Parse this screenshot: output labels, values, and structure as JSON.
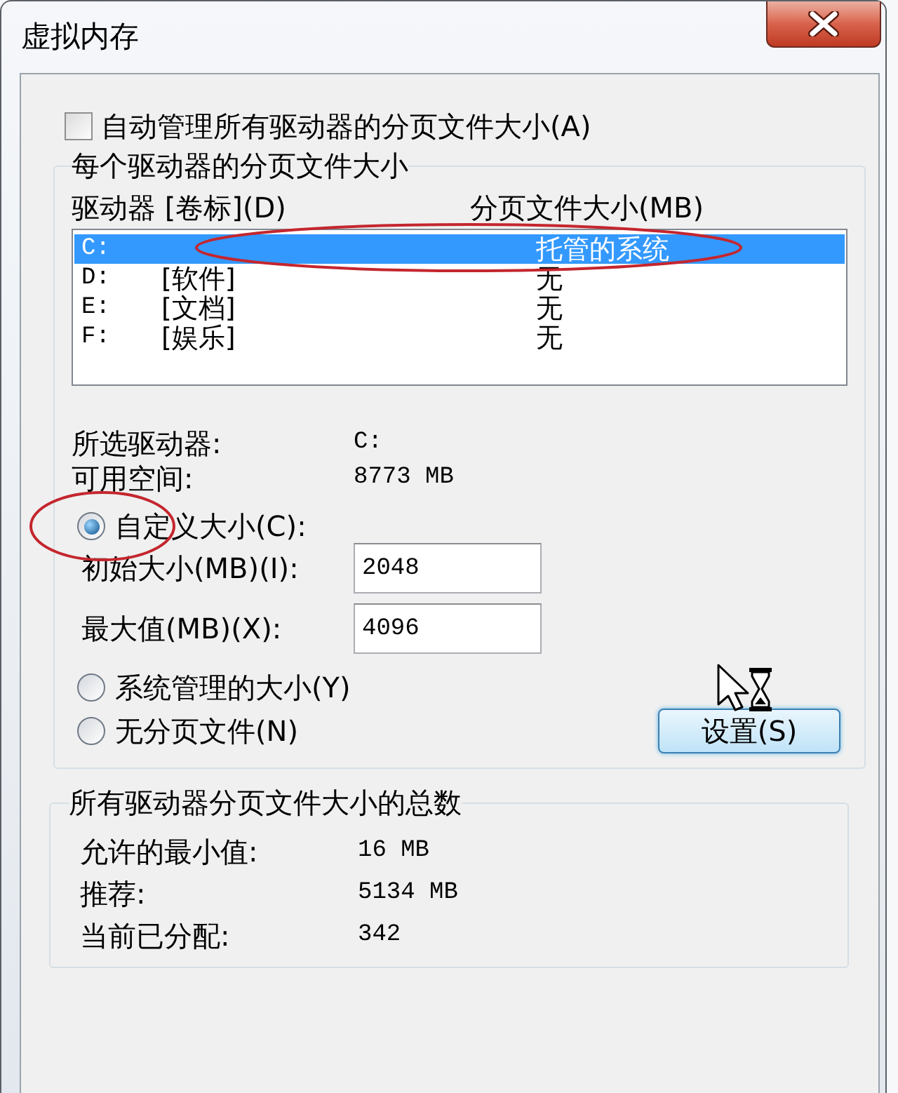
{
  "window": {
    "title": "虚拟内存"
  },
  "auto_manage": {
    "label": "自动管理所有驱动器的分页文件大小(A)",
    "checked": false
  },
  "per_drive_group": {
    "title": "每个驱动器的分页文件大小",
    "columns": [
      "驱动器 [卷标](D)",
      "分页文件大小(MB)"
    ],
    "drives": [
      {
        "drive": "C:",
        "paging_file_size": "托管的系统",
        "selected": true
      },
      {
        "drive": "D:",
        "volume_label": "[软件]",
        "paging_file_size": "无",
        "selected": false
      },
      {
        "drive": "E:",
        "volume_label": "[文档]",
        "paging_file_size": "无",
        "selected": false
      },
      {
        "drive": "F:",
        "volume_label": "[娱乐]",
        "paging_file_size": "无",
        "selected": false
      }
    ],
    "selected_drive": {
      "label": "所选驱动器:",
      "value": "C:"
    },
    "free_space": {
      "label": "可用空间:",
      "value": "8773 MB"
    },
    "size_options": [
      {
        "label": "自定义大小(C):",
        "selected": true,
        "fields": [
          {
            "label": "初始大小(MB)(I):",
            "value": "2048"
          },
          {
            "label": "最大值(MB)(X):",
            "value": "4096"
          }
        ]
      },
      {
        "label": "系统管理的大小(Y)",
        "selected": false
      },
      {
        "label": "无分页文件(N)",
        "selected": false
      }
    ],
    "set_button": "设置(S)"
  },
  "totals_group": {
    "title": "所有驱动器分页文件大小的总数",
    "rows": [
      {
        "label": "允许的最小值:",
        "value": "16 MB"
      },
      {
        "label": "推荐:",
        "value": "5134 MB"
      },
      {
        "label": "当前已分配:",
        "value": "342"
      }
    ]
  }
}
